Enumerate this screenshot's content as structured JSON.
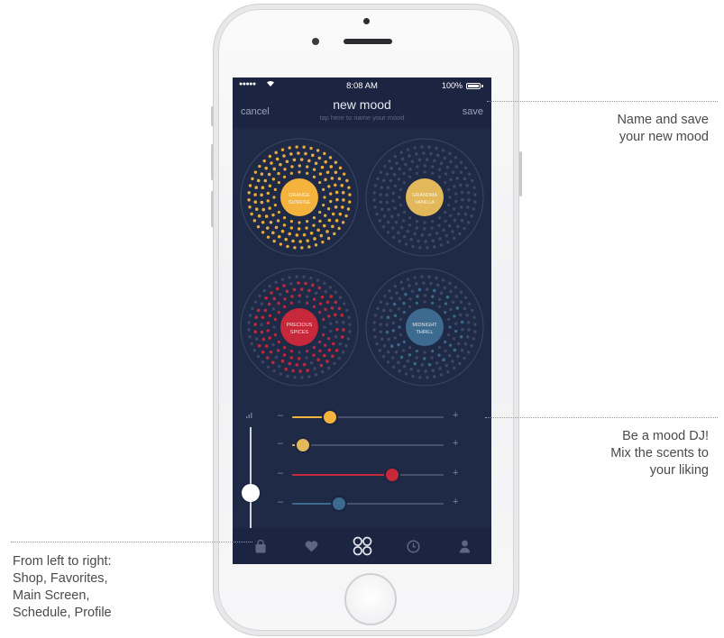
{
  "status_bar": {
    "signal": "●●●●●",
    "wifi_icon": "wifi-icon",
    "time": "8:08 AM",
    "battery": "100%"
  },
  "nav": {
    "cancel": "cancel",
    "title": "new mood",
    "subtitle": "tap here to name your mood",
    "save": "save"
  },
  "scents": [
    {
      "line1": "ORANGE",
      "line2": "SUNRISE",
      "color": "#f3b33d"
    },
    {
      "line1": "GRANDMA",
      "line2": "VANILLA",
      "color": "#e3b85a"
    },
    {
      "line1": "PRECIOUS",
      "line2": "SPICES",
      "color": "#c7283a"
    },
    {
      "line1": "MIDNIGHT",
      "line2": "THRILL",
      "color": "#3d6a8f"
    }
  ],
  "sliders": [
    {
      "minus": "–",
      "plus": "+",
      "value": 0.25,
      "color": "#f3b33d"
    },
    {
      "minus": "–",
      "plus": "+",
      "value": 0.07,
      "color": "#e3b85a"
    },
    {
      "minus": "–",
      "plus": "+",
      "value": 0.66,
      "color": "#c7283a"
    },
    {
      "minus": "–",
      "plus": "+",
      "value": 0.31,
      "color": "#3d6a8f"
    }
  ],
  "master_level": 0.4,
  "tabs": [
    {
      "name": "Shop",
      "icon": "bag-icon",
      "active": false
    },
    {
      "name": "Favorites",
      "icon": "heart-icon",
      "active": false
    },
    {
      "name": "Main Screen",
      "icon": "four-circles-icon",
      "active": true
    },
    {
      "name": "Schedule",
      "icon": "clock-icon",
      "active": false
    },
    {
      "name": "Profile",
      "icon": "person-icon",
      "active": false
    }
  ],
  "callouts": {
    "top_line1": "Name and save",
    "top_line2": "your new mood",
    "mid_line1": "Be a mood DJ!",
    "mid_line2": "Mix the scents to",
    "mid_line3": "your liking",
    "left_line1": "From left to right:",
    "left_line2": "Shop, Favorites,",
    "left_line3": "Main Screen,",
    "left_line4": "Schedule, Profile"
  },
  "colors": {
    "screen_bg": "#1f2a47",
    "bar_bg": "#1b2440",
    "muted_text": "#9aa3bb"
  }
}
